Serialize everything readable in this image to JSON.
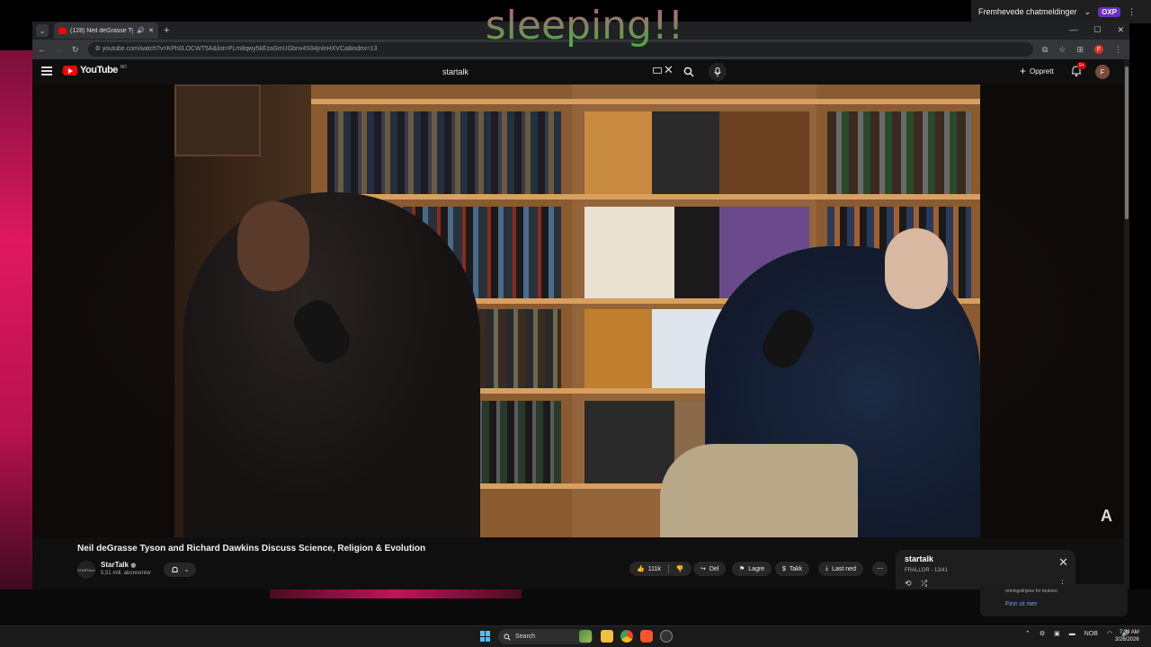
{
  "overlay": {
    "text": "sleeping!!"
  },
  "chat_bar": {
    "label": "Fremhevede chatmeldinger",
    "badge": "OXP"
  },
  "browser": {
    "tab_title": "(128) Neil deGrasse Tyson a",
    "url": "youtube.com/watch?v=KPh0LOCWT5A&list=PLm8qwy5kEzaSmUGbnv4S94jnlnHXVCa8index=13"
  },
  "youtube": {
    "logo_text": "YouTube",
    "logo_region": "NO",
    "search_value": "startalk",
    "create_label": "Opprett",
    "notification_count": "9+",
    "avatar_letter": "F"
  },
  "video": {
    "title": "Neil deGrasse Tyson and Richard Dawkins Discuss Science, Religion & Evolution",
    "channel_name": "StarTalk",
    "channel_avatar_text": "STARTALK",
    "subscribers": "5,51 mill. abonnenter",
    "likes": "111k",
    "share_label": "Del",
    "save_label": "Lagre",
    "thanks_label": "Takk",
    "download_label": "Last ned",
    "player_mark": "A"
  },
  "playlist": {
    "title": "startalk",
    "meta": "FRALLOR - 13/41"
  },
  "notification": {
    "text": "retningslinjene for brukere.",
    "link": "Finn ut mer"
  },
  "taskbar": {
    "search_label": "Search",
    "language": "NOB",
    "time": "7:39 AM",
    "date": "3/26/2026"
  },
  "colors": {
    "yt_red": "#ff0000",
    "desktop_pink": "#e0185f",
    "link_blue": "#6ba3ff",
    "background": "#0f0f0f"
  }
}
